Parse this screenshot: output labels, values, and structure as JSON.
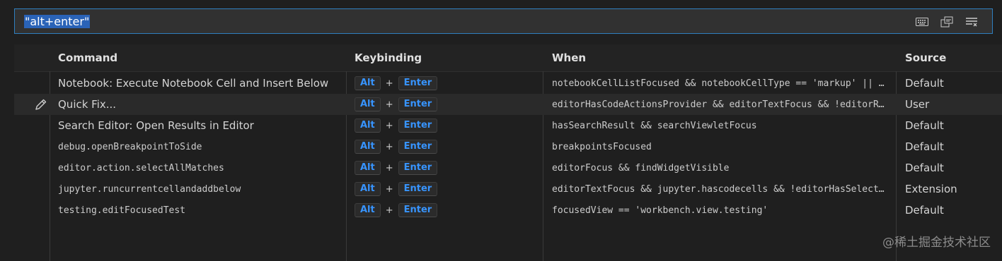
{
  "search": {
    "value": "\"alt+enter\""
  },
  "icons": [
    "keyboard-icon",
    "record-keys-icon",
    "clear-filter-icon"
  ],
  "table": {
    "headers": {
      "command": "Command",
      "keybinding": "Keybinding",
      "when": "When",
      "source": "Source"
    },
    "rows": [
      {
        "command": "Notebook: Execute Notebook Cell and Insert Below",
        "mono": false,
        "key1": "Alt",
        "plus": "+",
        "key2": "Enter",
        "when": "notebookCellListFocused && notebookCellType == 'markup' || …",
        "source": "Default"
      },
      {
        "command": "Quick Fix...",
        "mono": false,
        "key1": "Alt",
        "plus": "+",
        "key2": "Enter",
        "when": "editorHasCodeActionsProvider && editorTextFocus && !editorR…",
        "source": "User"
      },
      {
        "command": "Search Editor: Open Results in Editor",
        "mono": false,
        "key1": "Alt",
        "plus": "+",
        "key2": "Enter",
        "when": "hasSearchResult && searchViewletFocus",
        "source": "Default"
      },
      {
        "command": "debug.openBreakpointToSide",
        "mono": true,
        "key1": "Alt",
        "plus": "+",
        "key2": "Enter",
        "when": "breakpointsFocused",
        "source": "Default"
      },
      {
        "command": "editor.action.selectAllMatches",
        "mono": true,
        "key1": "Alt",
        "plus": "+",
        "key2": "Enter",
        "when": "editorFocus && findWidgetVisible",
        "source": "Default"
      },
      {
        "command": "jupyter.runcurrentcellandaddbelow",
        "mono": true,
        "key1": "Alt",
        "plus": "+",
        "key2": "Enter",
        "when": "editorTextFocus && jupyter.hascodecells && !editorHasSelect…",
        "source": "Extension"
      },
      {
        "command": "testing.editFocusedTest",
        "mono": true,
        "key1": "Alt",
        "plus": "+",
        "key2": "Enter",
        "when": "focusedView == 'workbench.view.testing'",
        "source": "Default"
      }
    ]
  },
  "watermark": "@稀土掘金技术社区",
  "colors": {
    "accent": "#3794ff",
    "focus_border": "#2f7fbf",
    "selection": "#2a63b7"
  }
}
